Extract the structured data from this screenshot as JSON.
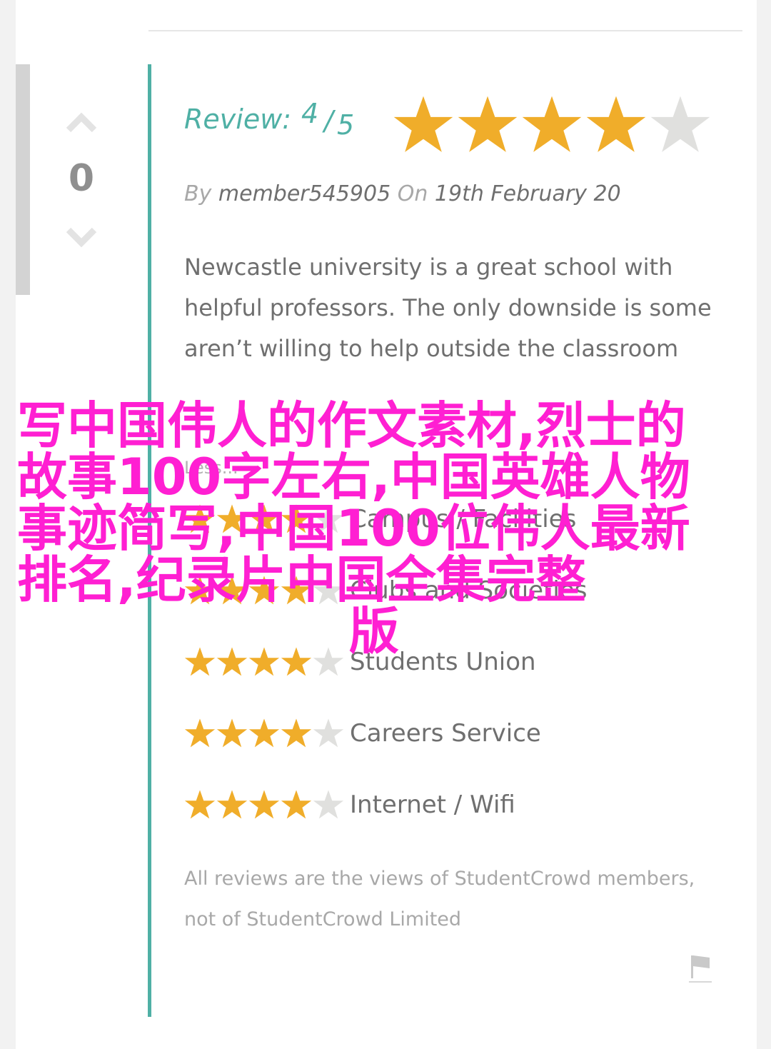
{
  "vote": {
    "count": "0"
  },
  "review": {
    "label": "Review:",
    "score": "4",
    "slash": "/",
    "out_of": "5",
    "stars_filled": 4,
    "stars_total": 5
  },
  "byline": {
    "by": "By",
    "author": "member545905",
    "on": "On",
    "date": "19th February 20"
  },
  "body_text": "Newcastle university is a great school with helpful professors. The only downside is some aren’t willing to help outside the classroom",
  "pros_label": "Less...",
  "ratings": [
    {
      "category": "Campus / Facilities",
      "stars_filled": 4
    },
    {
      "category": "Clubs and Societies",
      "stars_filled": 4
    },
    {
      "category": "Students Union",
      "stars_filled": 4
    },
    {
      "category": "Careers Service",
      "stars_filled": 4
    },
    {
      "category": "Internet / Wifi",
      "stars_filled": 4
    }
  ],
  "disclaimer": "All reviews are the views of StudentCrowd members, not of StudentCrowd Limited",
  "overlay": {
    "main": "写中国伟人的作文素材,烈士的故事100字左右,中国英雄人物事迹简写,中国100位伟人最新排名,纪录片中国全集完整",
    "last": "版"
  },
  "colors": {
    "accent": "#4fb0a5",
    "star_filled": "#f0ad2a",
    "star_empty": "#e0e0de",
    "overlay": "#ff1fd2"
  },
  "icons": {
    "up": "chevron-up-icon",
    "down": "chevron-down-icon",
    "flag": "flag-icon",
    "star": "star-icon"
  }
}
